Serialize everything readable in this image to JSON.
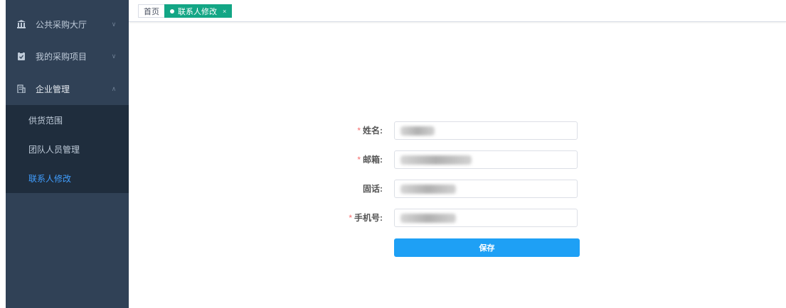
{
  "sidebar": {
    "menus": [
      {
        "label": "公共采购大厅",
        "icon": "bank-icon"
      },
      {
        "label": "我的采购项目",
        "icon": "clipboard-icon"
      },
      {
        "label": "企业管理",
        "icon": "building-icon"
      }
    ],
    "submenu": [
      {
        "label": "供货范围"
      },
      {
        "label": "团队人员管理"
      },
      {
        "label": "联系人修改"
      }
    ]
  },
  "tags": {
    "home": "首页",
    "active": "联系人修改",
    "close": "×"
  },
  "form": {
    "name_label": "姓名:",
    "email_label": "邮箱:",
    "phone_label": "固话:",
    "mobile_label": "手机号:",
    "required_mark": "*",
    "save_label": "保存"
  },
  "colors": {
    "sidebar_bg": "#304156",
    "submenu_bg": "#1f2d3d",
    "active_menu_text": "#409eff",
    "active_tag": "#13a685",
    "button": "#1ea0f5",
    "required": "#f56c6c"
  }
}
